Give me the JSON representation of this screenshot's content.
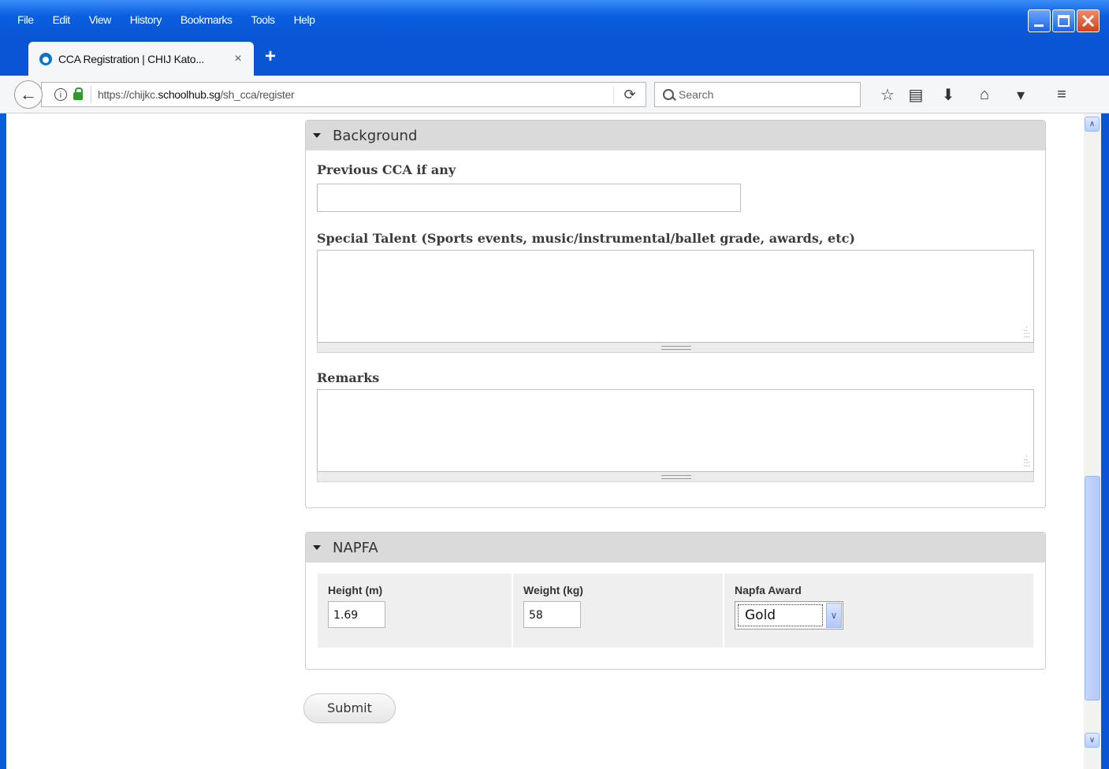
{
  "browser": {
    "menu": [
      "File",
      "Edit",
      "View",
      "History",
      "Bookmarks",
      "Tools",
      "Help"
    ],
    "tab": {
      "title": "CCA Registration | CHIJ Kato...",
      "close": "×"
    },
    "new_tab": "+",
    "url": {
      "prefix": "https://chijkc.",
      "domain": "schoolhub.sg",
      "path": "/sh_cca/register"
    },
    "search": {
      "placeholder": "Search"
    }
  },
  "background_section": {
    "legend": "Background",
    "previous_cca_label": "Previous CCA if any",
    "previous_cca_value": "",
    "special_talent_label": "Special Talent (Sports events, music/instrumental/ballet grade, awards, etc)",
    "special_talent_value": "",
    "remarks_label": "Remarks",
    "remarks_value": ""
  },
  "napfa_section": {
    "legend": "NAPFA",
    "height_label": "Height (m)",
    "height_value": "1.69",
    "weight_label": "Weight (kg)",
    "weight_value": "58",
    "award_label": "Napfa Award",
    "award_value": "Gold"
  },
  "submit_label": "Submit"
}
